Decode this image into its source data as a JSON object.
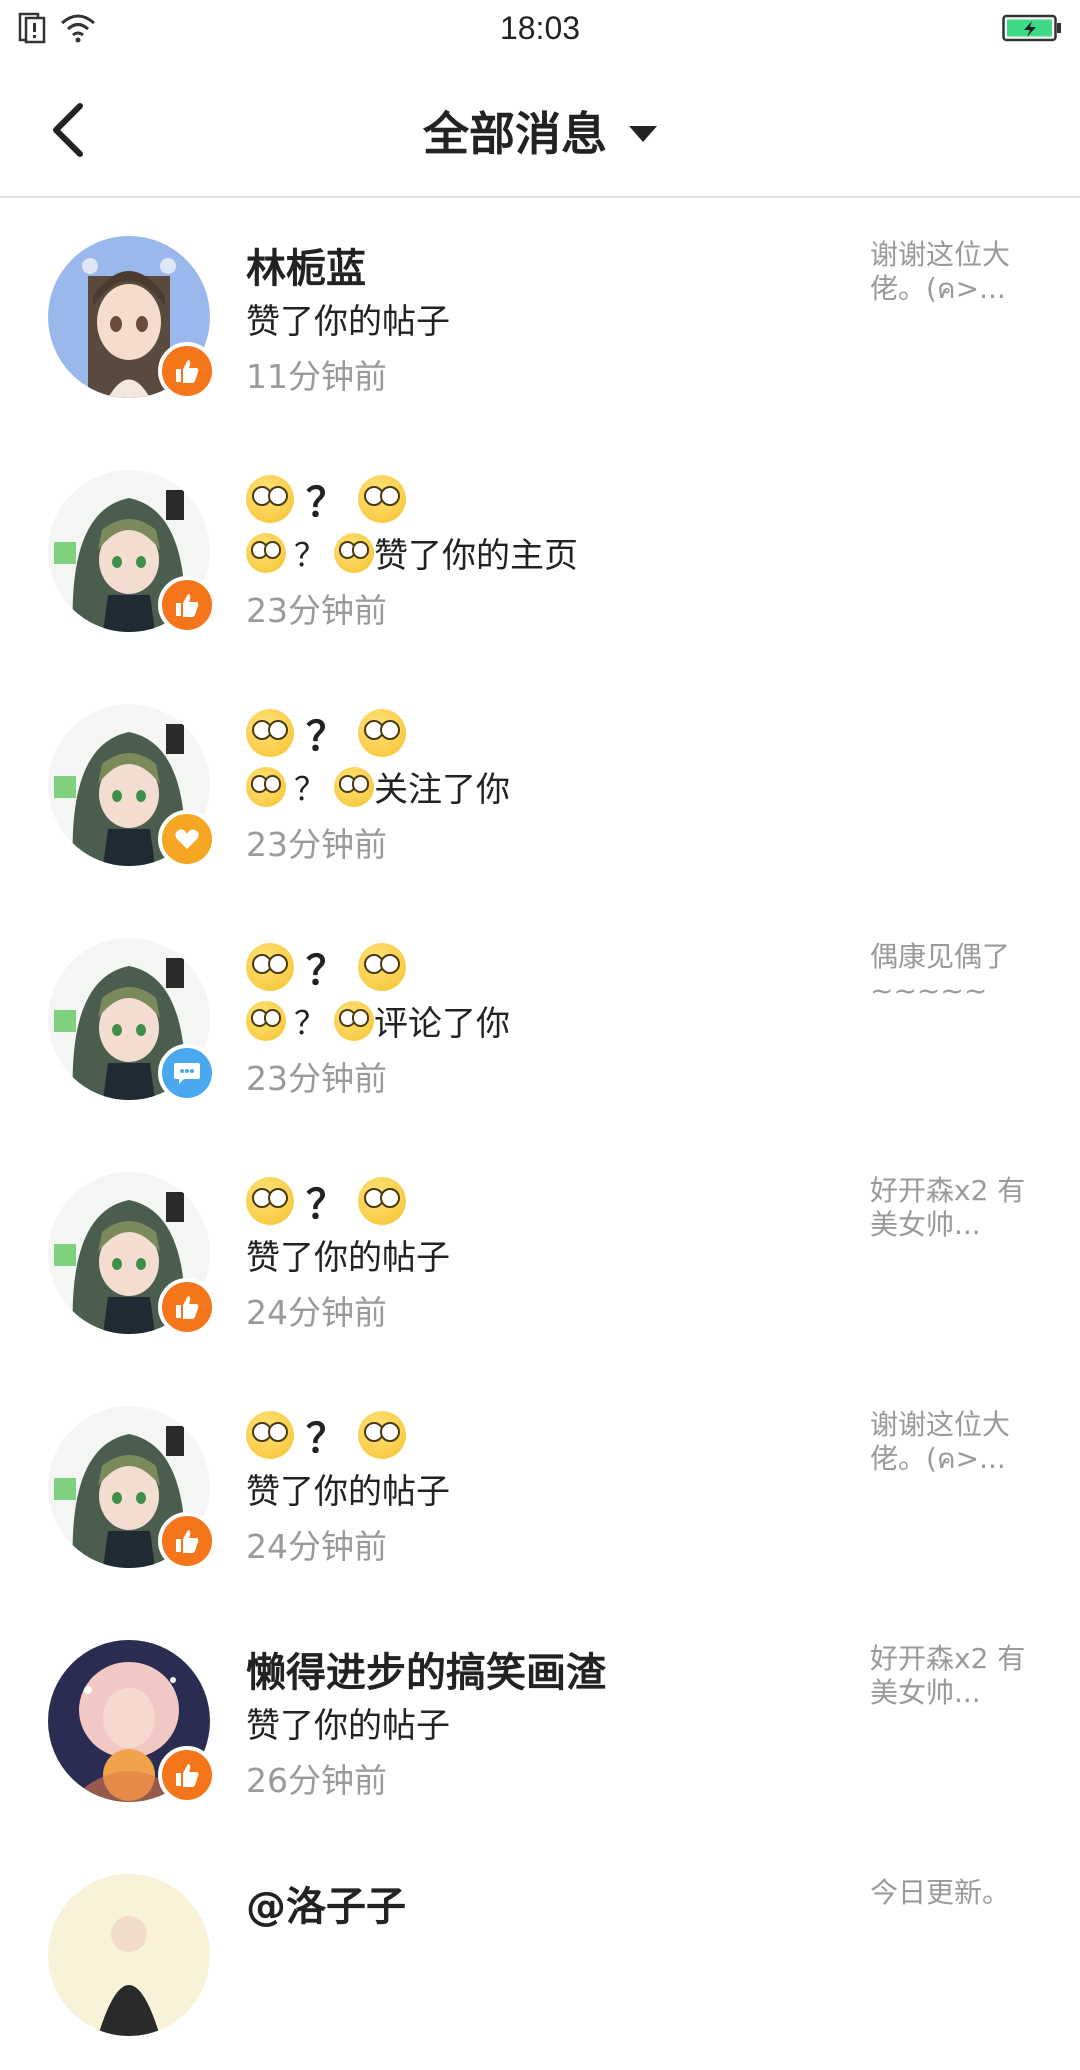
{
  "status_bar": {
    "time": "18:03"
  },
  "header": {
    "title": "全部消息"
  },
  "messages": [
    {
      "name": "林栀蓝",
      "action": "赞了你的帖子",
      "time": "11分钟前",
      "preview": "谢谢这位大佬。(ค>...",
      "badge": "like",
      "avatar": "girl"
    },
    {
      "name": "🙄？🙄",
      "action": "🙄？🙄赞了你的主页",
      "action_text": "赞了你的主页",
      "time": "23分钟前",
      "preview": "",
      "badge": "like",
      "avatar": "hood"
    },
    {
      "name": "🙄？🙄",
      "action": "🙄？🙄关注了你",
      "action_text": "关注了你",
      "time": "23分钟前",
      "preview": "",
      "badge": "follow",
      "avatar": "hood"
    },
    {
      "name": "🙄？🙄",
      "action": "🙄？🙄评论了你",
      "action_text": "评论了你",
      "time": "23分钟前",
      "preview": "偶康见偶了~~~~~",
      "badge": "comment",
      "avatar": "hood"
    },
    {
      "name": "🙄？🙄",
      "action": "赞了你的帖子",
      "time": "24分钟前",
      "preview": "好开森x2 有美女帅...",
      "badge": "like",
      "avatar": "hood"
    },
    {
      "name": "🙄？🙄",
      "action": "赞了你的帖子",
      "time": "24分钟前",
      "preview": "谢谢这位大佬。(ค>...",
      "badge": "like",
      "avatar": "hood"
    },
    {
      "name": "懒得进步的搞笑画渣",
      "action": "赞了你的帖子",
      "time": "26分钟前",
      "preview": "好开森x2 有美女帅...",
      "badge": "like",
      "avatar": "art"
    },
    {
      "name": "@洛子子",
      "action": "",
      "time": "",
      "preview": "今日更新。",
      "badge": "",
      "avatar": "cream"
    }
  ],
  "badge_colors": {
    "like": "#f5761a",
    "follow": "#f6a623",
    "comment": "#4aa8f0"
  }
}
